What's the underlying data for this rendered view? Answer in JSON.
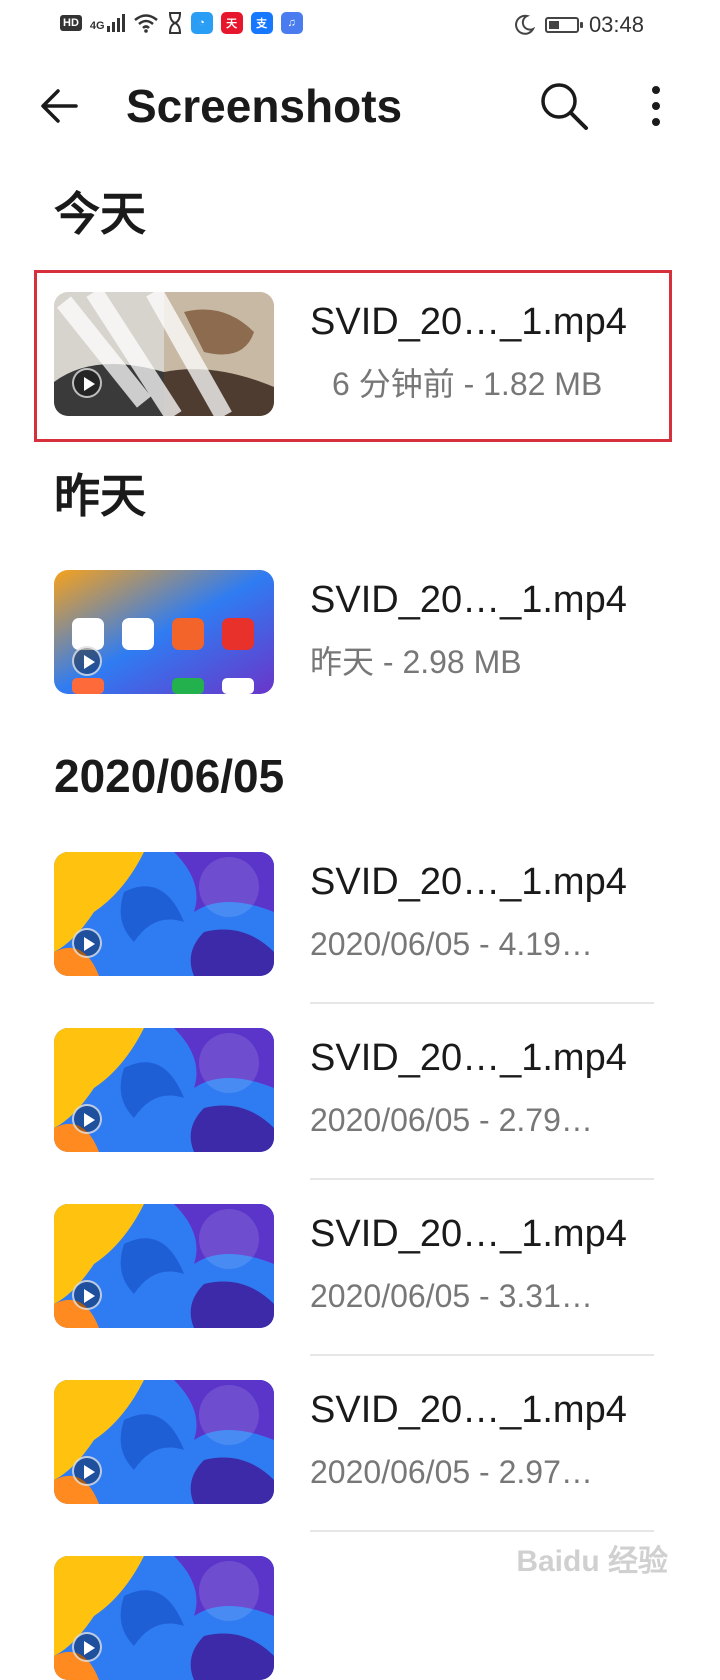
{
  "status_bar": {
    "hd": "HD",
    "network": "4G",
    "time": "03:48",
    "battery_level": 0.4,
    "app_icons": [
      {
        "name": "qq-browser-icon",
        "color": "#2a9df4",
        "glyph": "◔"
      },
      {
        "name": "tmall-icon",
        "color": "#e6162d",
        "glyph": "天"
      },
      {
        "name": "alipay-icon",
        "color": "#1677ff",
        "glyph": "支"
      },
      {
        "name": "music-icon",
        "color": "#4a7cf0",
        "glyph": "♫"
      }
    ]
  },
  "toolbar": {
    "title": "Screenshots"
  },
  "sections": [
    {
      "title": "今天"
    },
    {
      "title": "昨天"
    },
    {
      "title": "2020/06/05"
    }
  ],
  "items": [
    {
      "name": "SVID_20…_1.mp4",
      "meta": "6 分钟前 - 1.82 MB",
      "thumb": "mixed"
    },
    {
      "name": "SVID_20…_1.mp4",
      "meta": "昨天 - 2.98 MB",
      "thumb": "homescreen"
    },
    {
      "name": "SVID_20…_1.mp4",
      "meta": "2020/06/05 - 4.19…",
      "thumb": "wallpaper"
    },
    {
      "name": "SVID_20…_1.mp4",
      "meta": "2020/06/05 - 2.79…",
      "thumb": "wallpaper"
    },
    {
      "name": "SVID_20…_1.mp4",
      "meta": "2020/06/05 - 3.31…",
      "thumb": "wallpaper"
    },
    {
      "name": "SVID_20…_1.mp4",
      "meta": "2020/06/05 - 2.97…",
      "thumb": "wallpaper"
    }
  ],
  "colors": {
    "highlight": "#d7303d",
    "wallpaper_blue": "#2f7cf2",
    "wallpaper_yellow": "#ffc20e",
    "wallpaper_purple": "#5b35c9"
  },
  "watermark": "Baidu 经验"
}
